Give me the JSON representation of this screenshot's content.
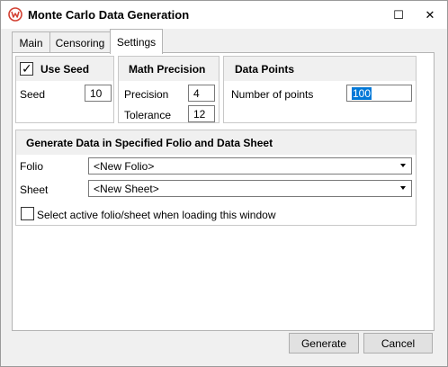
{
  "window": {
    "title": "Monte Carlo Data Generation",
    "icon": "app-logo-icon",
    "maximize_glyph": "☐",
    "close_glyph": "✕"
  },
  "tabs": [
    {
      "label": "Main",
      "active": false
    },
    {
      "label": "Censoring",
      "active": false
    },
    {
      "label": "Settings",
      "active": true
    }
  ],
  "use_seed": {
    "label": "Use Seed",
    "checked": true,
    "check_glyph": "✓",
    "seed_label": "Seed",
    "seed_value": "10"
  },
  "math_precision": {
    "title": "Math Precision",
    "precision_label": "Precision",
    "precision_value": "4",
    "tolerance_label": "Tolerance",
    "tolerance_value": "12"
  },
  "data_points": {
    "title": "Data Points",
    "points_label": "Number of points",
    "points_value": "100"
  },
  "generate": {
    "title": "Generate Data in Specified Folio and Data Sheet",
    "folio_label": "Folio",
    "folio_value": "<New Folio>",
    "sheet_label": "Sheet",
    "sheet_value": "<New Sheet>",
    "active_checkbox_label": "Select active folio/sheet when loading this window",
    "active_checked": false
  },
  "buttons": {
    "generate": "Generate",
    "cancel": "Cancel"
  },
  "colors": {
    "accent": "#0078d7",
    "logo": "#d23f31"
  }
}
